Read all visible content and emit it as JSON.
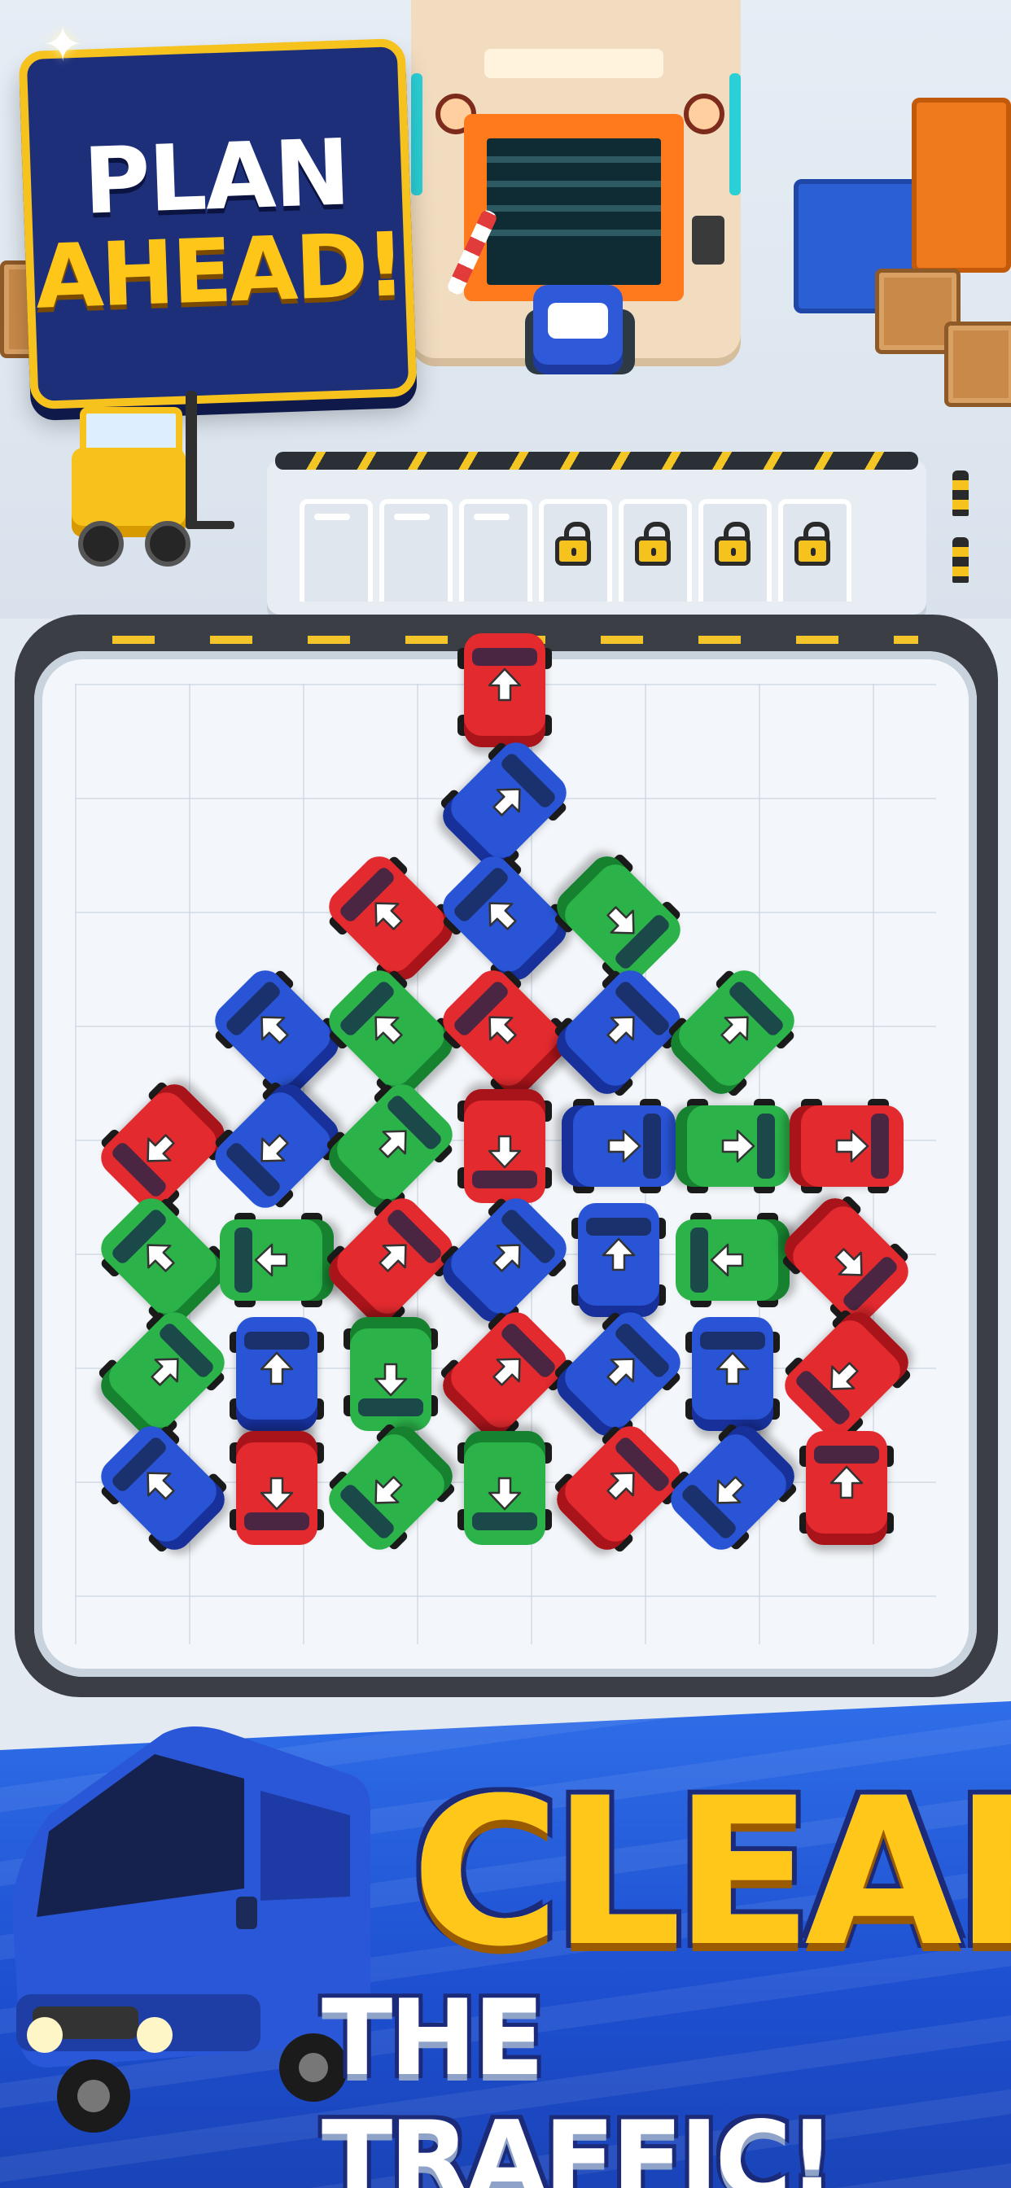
{
  "top_sign": {
    "line1": "PLAN",
    "line2": "AHEAD!"
  },
  "queue": {
    "open_slots": 3,
    "locked_slots": 4,
    "lock_icon": "padlock-icon"
  },
  "bottom_banner": {
    "line1": "CLEAR",
    "line2": "THE TRAFFIC!"
  },
  "colors": {
    "red": "#e22a2f",
    "blue": "#2a54d6",
    "green": "#2bb34a",
    "accent_yellow": "#ffc71a",
    "sign_navy": "#1e2f7a"
  },
  "cars": [
    {
      "color": "red",
      "dir": "up",
      "col": 3,
      "row": 0
    },
    {
      "color": "blue",
      "dir": "upright",
      "col": 3,
      "row": 1
    },
    {
      "color": "red",
      "dir": "upleft",
      "col": 2,
      "row": 2
    },
    {
      "color": "blue",
      "dir": "upleft",
      "col": 3,
      "row": 2
    },
    {
      "color": "green",
      "dir": "downright",
      "col": 4,
      "row": 2
    },
    {
      "color": "blue",
      "dir": "upleft",
      "col": 1,
      "row": 3
    },
    {
      "color": "green",
      "dir": "upleft",
      "col": 2,
      "row": 3
    },
    {
      "color": "red",
      "dir": "upleft",
      "col": 3,
      "row": 3
    },
    {
      "color": "blue",
      "dir": "upright",
      "col": 4,
      "row": 3
    },
    {
      "color": "green",
      "dir": "upright",
      "col": 5,
      "row": 3
    },
    {
      "color": "red",
      "dir": "downleft",
      "col": 0,
      "row": 4
    },
    {
      "color": "blue",
      "dir": "downleft",
      "col": 1,
      "row": 4
    },
    {
      "color": "green",
      "dir": "upright",
      "col": 2,
      "row": 4
    },
    {
      "color": "red",
      "dir": "down",
      "col": 3,
      "row": 4
    },
    {
      "color": "blue",
      "dir": "right",
      "col": 4,
      "row": 4
    },
    {
      "color": "green",
      "dir": "right",
      "col": 5,
      "row": 4
    },
    {
      "color": "red",
      "dir": "right",
      "col": 6,
      "row": 4
    },
    {
      "color": "green",
      "dir": "upleft",
      "col": 0,
      "row": 5
    },
    {
      "color": "green",
      "dir": "left",
      "col": 1,
      "row": 5
    },
    {
      "color": "red",
      "dir": "upright",
      "col": 2,
      "row": 5
    },
    {
      "color": "blue",
      "dir": "upright",
      "col": 3,
      "row": 5
    },
    {
      "color": "blue",
      "dir": "up",
      "col": 4,
      "row": 5
    },
    {
      "color": "green",
      "dir": "left",
      "col": 5,
      "row": 5
    },
    {
      "color": "red",
      "dir": "downright",
      "col": 6,
      "row": 5
    },
    {
      "color": "green",
      "dir": "upright",
      "col": 0,
      "row": 6
    },
    {
      "color": "blue",
      "dir": "up",
      "col": 1,
      "row": 6
    },
    {
      "color": "green",
      "dir": "down",
      "col": 2,
      "row": 6
    },
    {
      "color": "red",
      "dir": "upright",
      "col": 3,
      "row": 6
    },
    {
      "color": "blue",
      "dir": "upright",
      "col": 4,
      "row": 6
    },
    {
      "color": "blue",
      "dir": "up",
      "col": 5,
      "row": 6
    },
    {
      "color": "red",
      "dir": "downleft",
      "col": 6,
      "row": 6
    },
    {
      "color": "blue",
      "dir": "upleft",
      "col": 0,
      "row": 7
    },
    {
      "color": "red",
      "dir": "down",
      "col": 1,
      "row": 7
    },
    {
      "color": "green",
      "dir": "downleft",
      "col": 2,
      "row": 7
    },
    {
      "color": "green",
      "dir": "down",
      "col": 3,
      "row": 7
    },
    {
      "color": "red",
      "dir": "upright",
      "col": 4,
      "row": 7
    },
    {
      "color": "blue",
      "dir": "downleft",
      "col": 5,
      "row": 7
    },
    {
      "color": "red",
      "dir": "up",
      "col": 6,
      "row": 7
    }
  ]
}
